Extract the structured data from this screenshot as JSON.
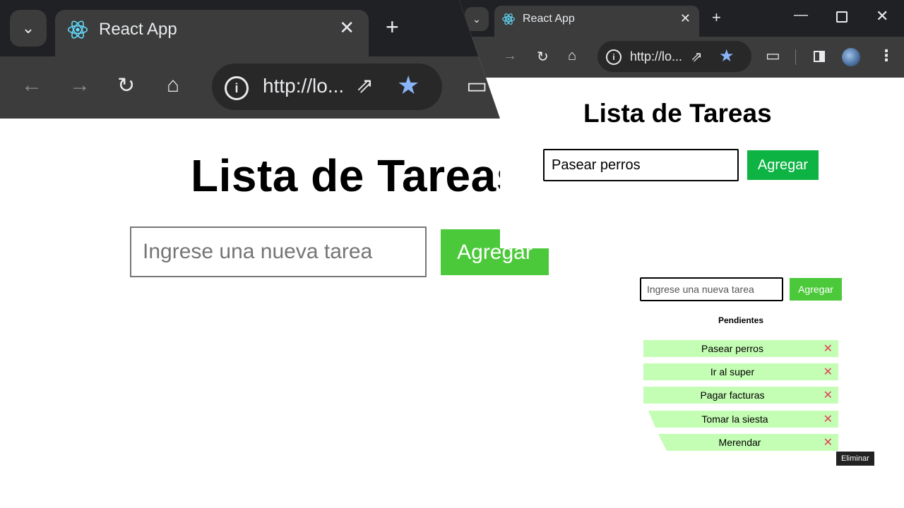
{
  "large_window": {
    "tab_title": "React App",
    "url": "http://lo...",
    "icons": {
      "dropdown": "chevron-down-icon",
      "close_tab": "close-icon",
      "new_tab": "plus-icon",
      "back": "arrow-left-icon",
      "forward": "arrow-right-icon",
      "reload": "reload-icon",
      "home": "home-icon",
      "info": "info-icon",
      "open": "open-external-icon",
      "bookmark": "star-icon",
      "extensions": "puzzle-icon"
    },
    "heading": "Lista de Tareas",
    "input_placeholder": "Ingrese una nueva tarea",
    "add_button": "Agregar",
    "colors": {
      "chrome_dark": "#202124",
      "toolbar": "#3c3c3c",
      "accent_button": "#4cc93a",
      "bookmark_star": "#8ab4f8"
    }
  },
  "small_window": {
    "tab_title": "React App",
    "url": "http://lo...",
    "heading": "Lista de Tareas",
    "input_value": "Pasear perros",
    "add_button": "Agregar",
    "colors": {
      "add_button": "#0db343"
    }
  },
  "list_view": {
    "input_placeholder": "Ingrese una nueva tarea",
    "add_button": "Agregar",
    "section_title": "Pendientes",
    "tasks": [
      {
        "label": "Pasear perros",
        "delete": "✕"
      },
      {
        "label": "Ir al super",
        "delete": "✕"
      },
      {
        "label": "Pagar facturas",
        "delete": "✕"
      },
      {
        "label": "Tomar la siesta",
        "delete": "✕"
      },
      {
        "label": "Merendar",
        "delete": "✕"
      }
    ],
    "tooltip": "Eliminar",
    "colors": {
      "task_background": "#c4fdb4",
      "delete_icon": "#e0425a",
      "add_button": "#4cc93a"
    }
  }
}
